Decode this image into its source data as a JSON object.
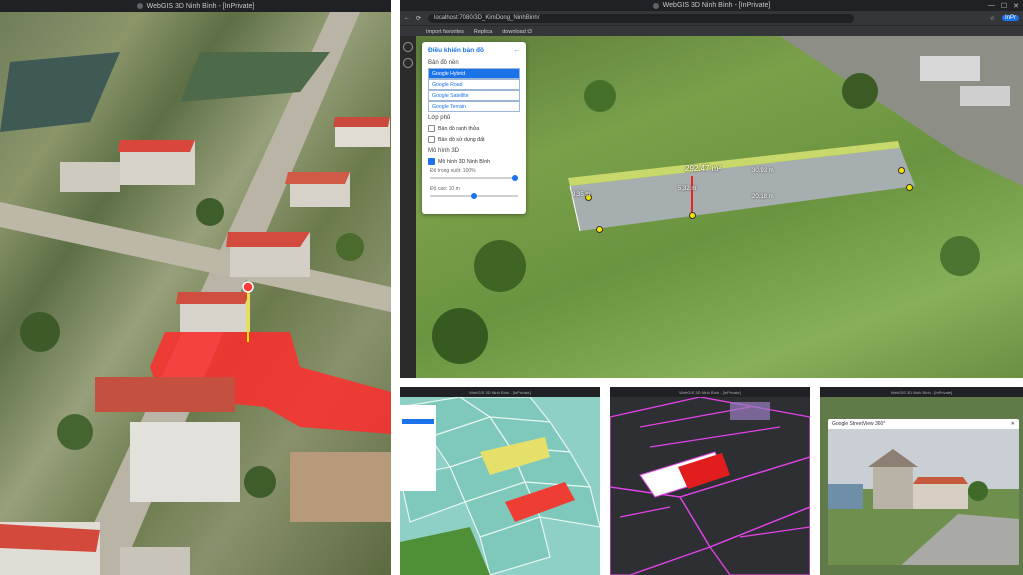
{
  "left_window": {
    "title": "WebGIS 3D Ninh Bình - [InPrivate]",
    "window_controls": [
      "—",
      "☐",
      "✕"
    ]
  },
  "main_window": {
    "title": "WebGIS 3D Ninh Bình - [InPrivate]",
    "url": "localhost:7080/3D_KimDong_NinhBinh/",
    "bookmarks": [
      "Import favorites",
      "Replica",
      "download t3"
    ],
    "profile_label": "InPr",
    "control_panel": {
      "title": "Điều khiển bản đồ",
      "basemap_section": "Bản đồ nền",
      "basemaps": [
        "Google Hybrid",
        "Google Road",
        "Google Satellite",
        "Google Terrain"
      ],
      "selected_basemap": "Google Hybrid",
      "layers_section": "Lớp phủ",
      "layers": [
        {
          "label": "Bản đồ ranh thửa",
          "checked": false
        },
        {
          "label": "Bản đồ sử dụng đất",
          "checked": false
        }
      ],
      "model_section": "Mô hình 3D",
      "model_layer": {
        "label": "Mô hình 3D Ninh Bình",
        "checked": true
      },
      "opacity_label": "Độ trong suốt: 100%",
      "opacity_value": 1.0,
      "height_label": "Độ cao: 10 m",
      "height_value": 0.5
    },
    "measurements": {
      "area": "292.47 m²",
      "lengths": [
        "30.93 m",
        "20.18 m",
        "9.35 m"
      ],
      "height": "5.32 m"
    }
  },
  "mini_windows": [
    {
      "title": "WebGIS 3D Ninh Bình - [InPrivate]"
    },
    {
      "title": "WebGIS 3D Ninh Bình - [InPrivate]"
    },
    {
      "title": "WebGIS 3D Ninh Bình - [InPrivate]",
      "streetview_title": "Google StreetView 360°"
    }
  ],
  "colors": {
    "accent": "#1a73e8",
    "highlight_red": "#ff2d2d",
    "vertex_yellow": "#f5e600"
  }
}
